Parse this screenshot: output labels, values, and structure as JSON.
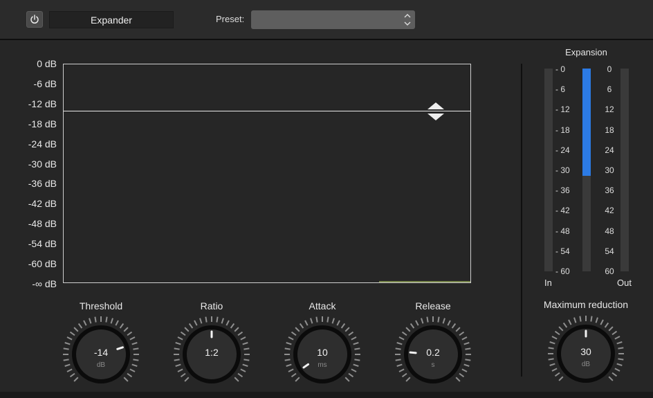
{
  "header": {
    "plugin_name": "Expander",
    "preset_label": "Preset:",
    "preset_value": ""
  },
  "graph": {
    "db_labels": [
      "0 dB",
      "-6 dB",
      "-12 dB",
      "-18 dB",
      "-24 dB",
      "-30 dB",
      "-36 dB",
      "-42 dB",
      "-48 dB",
      "-54 dB",
      "-60 dB",
      "-∞ dB"
    ],
    "threshold_db": -14
  },
  "meter": {
    "title": "Expansion",
    "scale_left": [
      "- 0",
      "- 6",
      "- 12",
      "- 18",
      "- 24",
      "- 30",
      "- 36",
      "- 42",
      "- 48",
      "- 54",
      "- 60"
    ],
    "scale_right": [
      "0",
      "6",
      "12",
      "18",
      "24",
      "30",
      "36",
      "42",
      "48",
      "54",
      "60"
    ],
    "in_label": "In",
    "out_label": "Out",
    "expansion_level_db": 30,
    "fill_color": "#2c7be5"
  },
  "knobs": {
    "threshold": {
      "label": "Threshold",
      "value": "-14",
      "unit": "dB",
      "angle": 72
    },
    "ratio": {
      "label": "Ratio",
      "value": "1:2",
      "unit": "",
      "angle": 0
    },
    "attack": {
      "label": "Attack",
      "value": "10",
      "unit": "ms",
      "angle": -125
    },
    "release": {
      "label": "Release",
      "value": "0.2",
      "unit": "s",
      "angle": -85
    },
    "max_reduction": {
      "label": "Maximum reduction",
      "value": "30",
      "unit": "dB",
      "angle": 0
    }
  }
}
